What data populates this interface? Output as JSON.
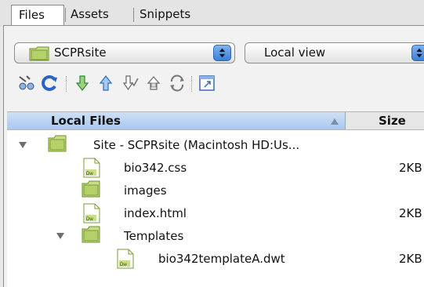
{
  "tabs": [
    {
      "label": "Files",
      "active": true
    },
    {
      "label": "Assets",
      "active": false
    },
    {
      "label": "Snippets",
      "active": false
    }
  ],
  "site_select": {
    "value": "SCPRsite"
  },
  "view_select": {
    "value": "Local view"
  },
  "toolbar": {
    "icons": [
      "connect-icon",
      "refresh-icon",
      "get-files-icon",
      "put-files-icon",
      "check-out-icon",
      "check-in-icon",
      "synchronize-icon",
      "expand-icon"
    ]
  },
  "columns": {
    "local": "Local Files",
    "size": "Size"
  },
  "tree": [
    {
      "name": "Site - SCPRsite (Macintosh HD:Us...",
      "size": "",
      "type": "site-folder",
      "level": 0,
      "expanded": true
    },
    {
      "name": "bio342.css",
      "size": "2KB",
      "type": "file",
      "level": 1
    },
    {
      "name": "images",
      "size": "",
      "type": "folder",
      "level": 1
    },
    {
      "name": "index.html",
      "size": "2KB",
      "type": "file",
      "level": 1
    },
    {
      "name": "Templates",
      "size": "",
      "type": "folder",
      "level": 1,
      "expanded": true
    },
    {
      "name": "bio342templateA.dwt",
      "size": "2KB",
      "type": "file",
      "level": 2
    }
  ],
  "colors": {
    "header_accent": "#a9c7ee",
    "stepper": "#3b7fd8",
    "folder": "#b5d16a",
    "arrow": "#2e9b3a"
  }
}
